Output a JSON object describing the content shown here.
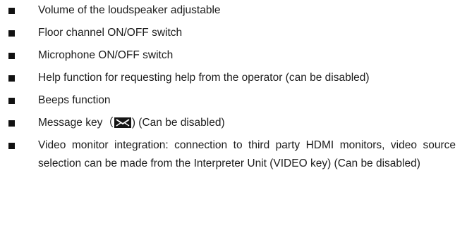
{
  "features": [
    {
      "text": "Volume of the loudspeaker adjustable"
    },
    {
      "text": "Floor channel ON/OFF switch"
    },
    {
      "text": "Microphone ON/OFF switch"
    },
    {
      "text": "Help function for requesting help from the operator (can be disabled)"
    },
    {
      "text": "Beeps function"
    },
    {
      "text_before": "Message key（",
      "icon": "envelope-icon",
      "text_after": ") (Can be disabled)"
    },
    {
      "text": "Video monitor integration: connection to third party HDMI monitors, video source selection can be made from the Interpreter Unit (VIDEO key) (Can be disabled)"
    }
  ]
}
